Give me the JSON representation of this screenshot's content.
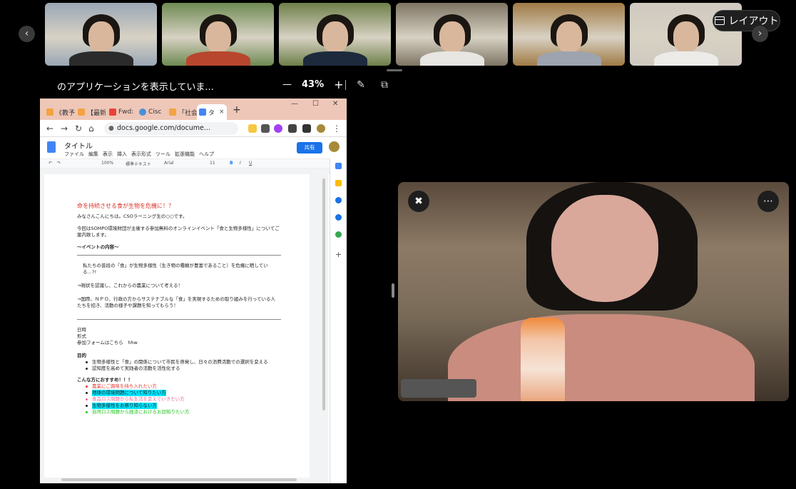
{
  "filmstrip": {
    "participants": [
      {
        "tile": "participant-1",
        "bg": "#9aa7b5",
        "shirt": "#2b2b2b"
      },
      {
        "tile": "participant-2",
        "bg": "#6e8a52",
        "shirt": "#b8462e"
      },
      {
        "tile": "participant-3",
        "bg": "#6d7f48",
        "shirt": "#1d2a3d"
      },
      {
        "tile": "participant-4",
        "bg": "#7d7463",
        "shirt": "#e8e6e2"
      },
      {
        "tile": "participant-5",
        "bg": "#a07a45",
        "shirt": "#9ea3b0"
      },
      {
        "tile": "participant-6",
        "bg": "#cfc9c1",
        "shirt": "#ecebe8"
      }
    ],
    "layout_label": "レイアウト"
  },
  "share_toolbar": {
    "title": "のアプリケーションを表示していま...",
    "zoom_minus": "—",
    "zoom_value": "43%",
    "zoom_plus": "+"
  },
  "browser": {
    "tabs": [
      "《教予",
      "【最新",
      "Fwd:",
      "Cisc",
      "「社会",
      "タ"
    ],
    "url": "docs.google.com/docume...",
    "doc": {
      "title": "タイトル",
      "menu": [
        "ファイル",
        "編集",
        "表示",
        "挿入",
        "表示形式",
        "ツール",
        "拡張機能",
        "ヘルプ"
      ],
      "share_label": "共有",
      "toolbar": {
        "zoom": "100%",
        "style": "標準テキスト",
        "font": "Arial",
        "size": "11"
      },
      "body": {
        "heading": "命を持続させる食が生物を危機に！？",
        "greeting": "みなさんこんにちは。CSOラーニング生の○○です。",
        "intro": "今回はSOMPO環境財団が主催する参加無料のオンラインイベント「食と生物多様性」についてご案内致します。",
        "section1": "〜イベントの内容〜",
        "para1": "私たちの普段の「食」が生物多様性（生き物の種類が豊富であること）を危機に晒している...?!",
        "para2": "→現状を認識し、これからの農業について考える！",
        "para3": "→国際、ＮＰＯ、行政の方からサステナブルな「食」を実現するための取り組みを行っている人たちを招き、活動の様子や課題を知ってもらう！",
        "info": [
          "日時",
          "形式",
          "参加フォームはこちら　hhw"
        ],
        "purpose_title": "目的",
        "purpose": [
          "生物多様性と「食」の関係について市民を啓発し、日々の消費活動での選択を変える",
          "認知度を高めて実践者の活動を活性化する"
        ],
        "recommend_title": "こんな方におすすめ！！！",
        "recommend": [
          "農業にご興味を持ち入れたい方",
          "地球の環境問題について知りたい方",
          "食品ロス問題から私生活を変えていきたい方",
          "生物多様性をお祭り知らない方",
          "自然ロス問題から経済におけるお話知りたい方"
        ]
      }
    }
  }
}
